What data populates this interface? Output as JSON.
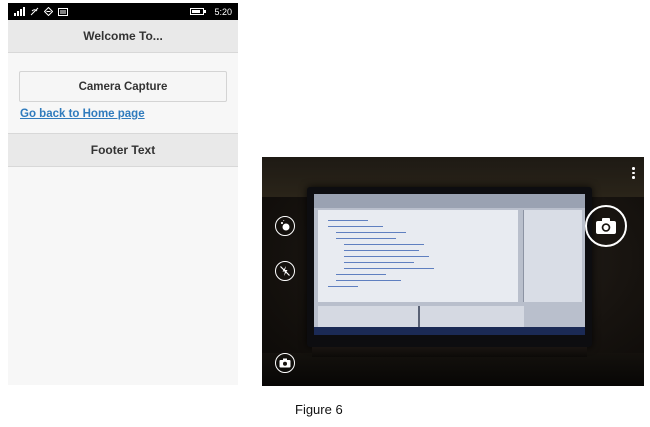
{
  "status_bar": {
    "time": "5:20"
  },
  "app": {
    "header_title": "Welcome To...",
    "capture_button_label": "Camera Capture",
    "home_link_label": "Go back to Home page",
    "footer_text": "Footer Text"
  },
  "camera": {
    "icons": {
      "effects": "lens-effects-icon",
      "flash": "flash-off-icon",
      "switch_camera": "switch-camera-icon",
      "shutter": "camera-shutter-icon",
      "more": "more-options-icon"
    }
  },
  "caption": "Figure 6"
}
